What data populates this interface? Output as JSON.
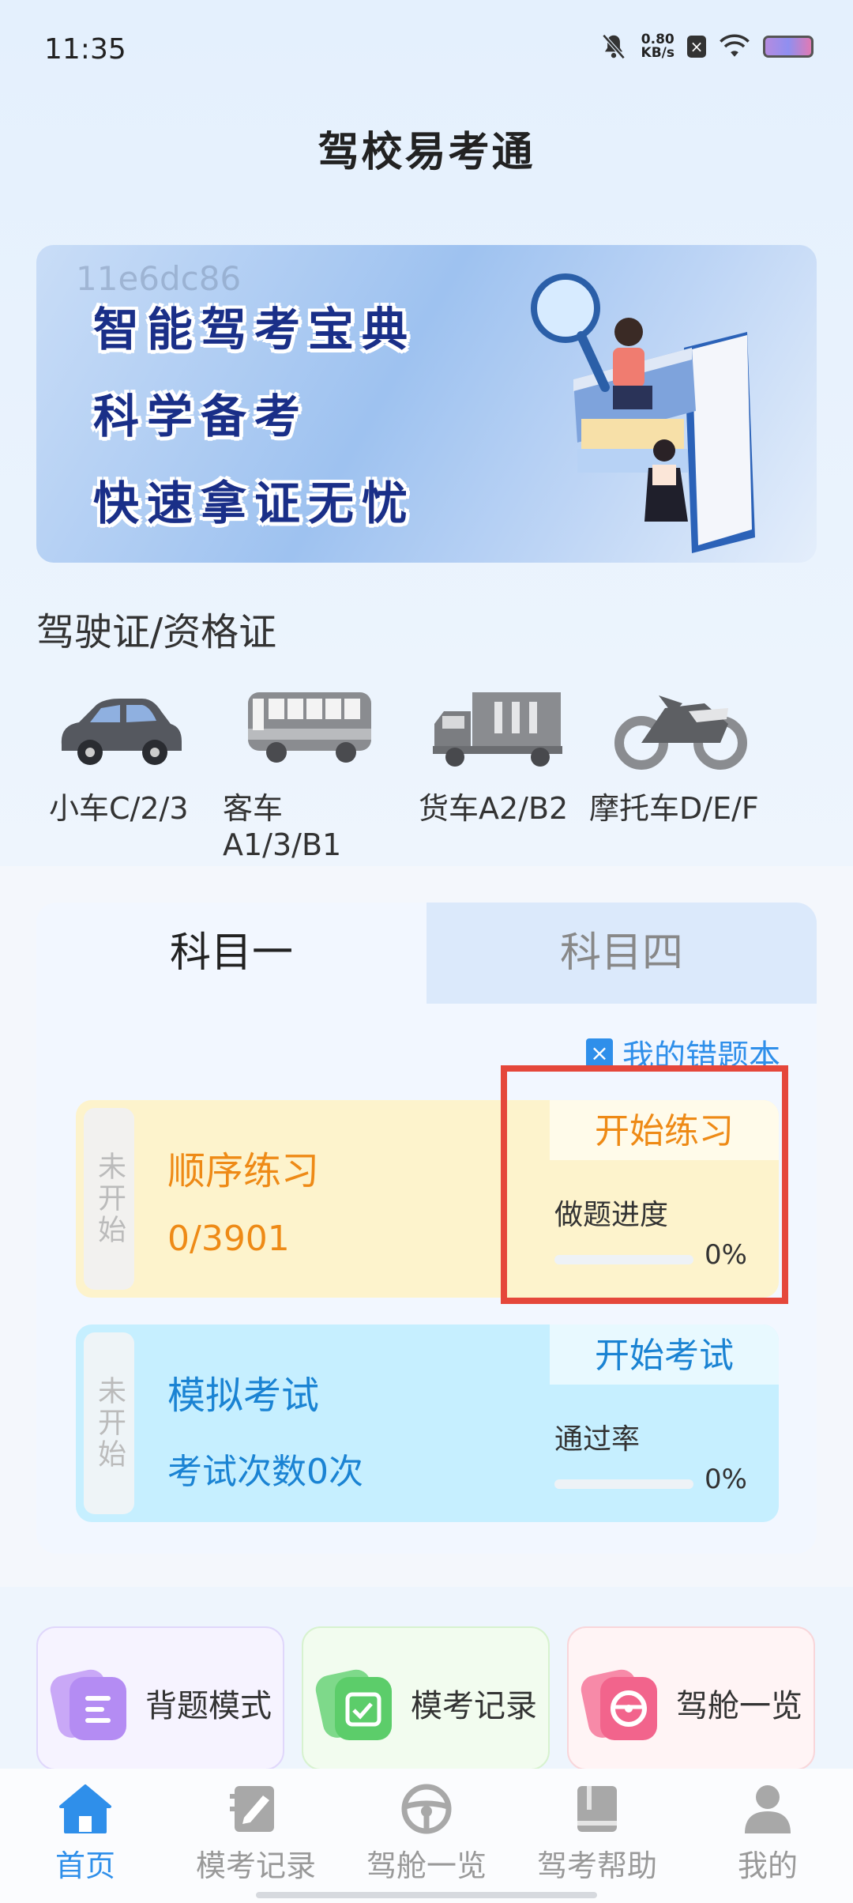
{
  "status_bar": {
    "time": "11:35",
    "net_speed_value": "0.80",
    "net_speed_unit": "KB/s"
  },
  "app": {
    "title": "驾校易考通"
  },
  "banner": {
    "watermark": "11e6dc86",
    "lines": [
      "智能驾考宝典",
      "科学备考",
      "快速拿证无忧"
    ]
  },
  "licenses": {
    "section_title": "驾驶证/资格证",
    "items": [
      {
        "label": "小车C/2/3",
        "icon": "car-icon"
      },
      {
        "label": "客车A1/3/B1",
        "icon": "bus-icon"
      },
      {
        "label": "货车A2/B2",
        "icon": "truck-icon"
      },
      {
        "label": "摩托车D/E/F",
        "icon": "motorcycle-icon"
      }
    ]
  },
  "subjects": {
    "tabs": [
      {
        "label": "科目一",
        "active": true
      },
      {
        "label": "科目四",
        "active": false
      }
    ],
    "wrong_book": "我的错题本",
    "sequential": {
      "status": "未开始",
      "title": "顺序练习",
      "progress_text": "0/3901",
      "button": "开始练习",
      "metric_label": "做题进度",
      "percent_text": "0%",
      "percent": 0
    },
    "mock": {
      "status": "未开始",
      "title": "模拟考试",
      "count_text": "考试次数0次",
      "button": "开始考试",
      "metric_label": "通过率",
      "percent_text": "0%",
      "percent": 0
    }
  },
  "quick_actions": [
    {
      "label": "背题模式",
      "icon": "document-icon",
      "color": "#b48cf3"
    },
    {
      "label": "模考记录",
      "icon": "calendar-check-icon",
      "color": "#5ccd6a"
    },
    {
      "label": "驾舱一览",
      "icon": "steering-wheel-icon",
      "color": "#f2648c"
    }
  ],
  "nav": [
    {
      "label": "首页",
      "icon": "home-icon",
      "active": true
    },
    {
      "label": "模考记录",
      "icon": "notebook-pen-icon",
      "active": false
    },
    {
      "label": "驾舱一览",
      "icon": "steering-wheel-icon",
      "active": false
    },
    {
      "label": "驾考帮助",
      "icon": "book-icon",
      "active": false
    },
    {
      "label": "我的",
      "icon": "user-icon",
      "active": false
    }
  ],
  "colors": {
    "accent": "#2f8fea",
    "sequential": "#ee8a16",
    "mock": "#1a83d3",
    "highlight": "#e5473b"
  }
}
